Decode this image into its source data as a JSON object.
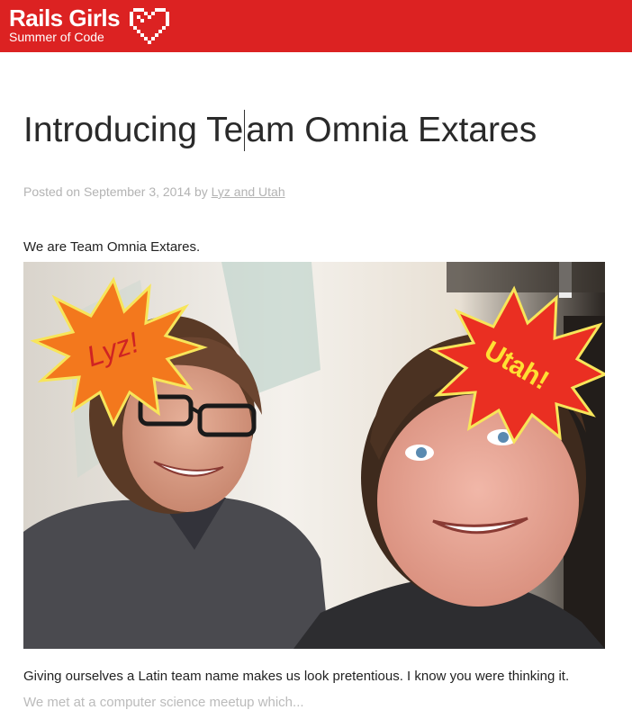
{
  "site": {
    "logo_title": "Rails Girls",
    "logo_subtitle": "Summer of Code",
    "bar_color": "#dc2222"
  },
  "post": {
    "title_part1": "Introducing Te",
    "title_part2": "am Omnia Extares",
    "posted_on_label": "Posted on",
    "date": "September 3, 2014",
    "by_label": "by",
    "author": "Lyz and Utah",
    "intro": "We are Team Omnia Extares.",
    "photo_labels": {
      "left": "Lyz!",
      "right": "Utah!"
    },
    "paragraph": "Giving ourselves a Latin team name makes us look pretentious. I know you were thinking it.",
    "next_line_partial": "We met at a computer science meetup which..."
  }
}
